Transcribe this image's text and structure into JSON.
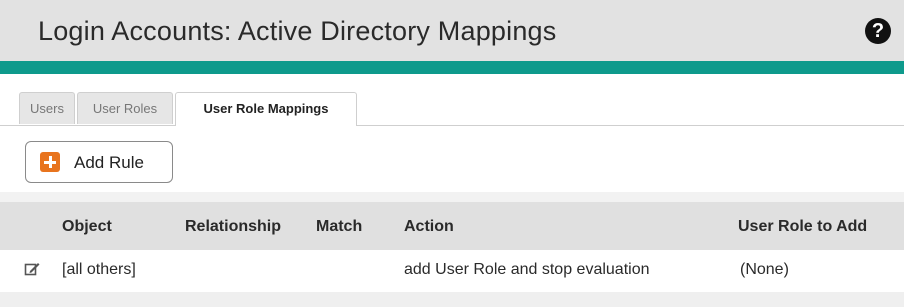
{
  "header": {
    "title": "Login Accounts: Active Directory Mappings",
    "help_icon": "help-icon"
  },
  "colors": {
    "accent_bar": "#0e9a8c",
    "add_icon": "#e8741e"
  },
  "tabs": [
    {
      "label": "Users",
      "active": false
    },
    {
      "label": "User Roles",
      "active": false
    },
    {
      "label": "User Role Mappings",
      "active": true
    }
  ],
  "toolbar": {
    "add_rule_label": "Add Rule",
    "add_rule_icon": "plus-square-icon"
  },
  "table": {
    "columns": [
      "Object",
      "Relationship",
      "Match",
      "Action",
      "User Role to Add"
    ],
    "rows": [
      {
        "edit_icon": "edit-icon",
        "object": "[all others]",
        "relationship": "",
        "match": "",
        "action": "add User Role and stop evaluation",
        "user_role": "(None)"
      }
    ]
  }
}
